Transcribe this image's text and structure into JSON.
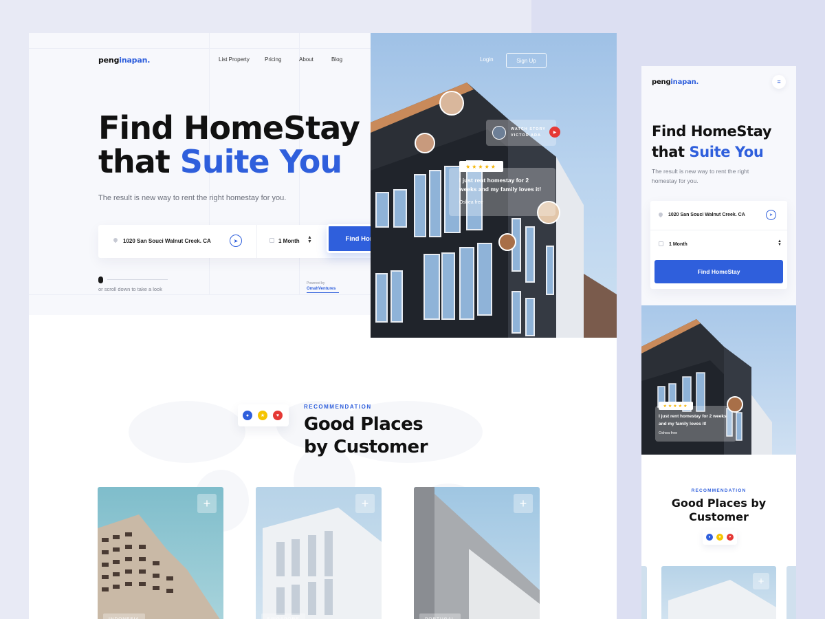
{
  "brand": {
    "logo_main": "peng",
    "logo_highlight": "inapan."
  },
  "nav": {
    "items": [
      "List Property",
      "Pricing",
      "About",
      "Blog"
    ],
    "login": "Login",
    "signup": "Sign Up"
  },
  "hero": {
    "title_line1": "Find HomeStay",
    "title_line2_plain": "that ",
    "title_line2_highlight": "Suite You",
    "subtitle": "The result is new way to rent the right homestay for you."
  },
  "search": {
    "address": "1020 San Souci Walnut Creek. CA",
    "duration": "1 Month",
    "button": "Find HomeStay"
  },
  "scroll_hint": "or scroll down to take a look",
  "powered": {
    "label": "Powered by",
    "brand": "OmahVentures"
  },
  "testimonial": {
    "stars": "★★★★★",
    "quote": "I just rent homestay for 2 weeks and my family loves it!",
    "author": "Oshea free",
    "watch_line1": "WATCH STORY",
    "watch_line2": "VICTOR ADA"
  },
  "recommendation": {
    "label": "RECOMMENDATION",
    "title_line1": "Good Places",
    "title_line2": "by Customer",
    "mobile_title_line1": "Good Places by",
    "mobile_title_line2": "Customer"
  },
  "cards": [
    {
      "location": "INDONESIA",
      "plus": "+"
    },
    {
      "location": "SINGAPORE",
      "plus": "+"
    },
    {
      "location": "PORTUGAL",
      "plus": "+"
    }
  ],
  "colors": {
    "accent": "#2f5fdc",
    "star": "#f5b400",
    "red": "#e53935"
  },
  "icons": {
    "menu": "≡",
    "location_arrow": "➤",
    "play": "▶",
    "heart": "♥",
    "star": "★"
  }
}
